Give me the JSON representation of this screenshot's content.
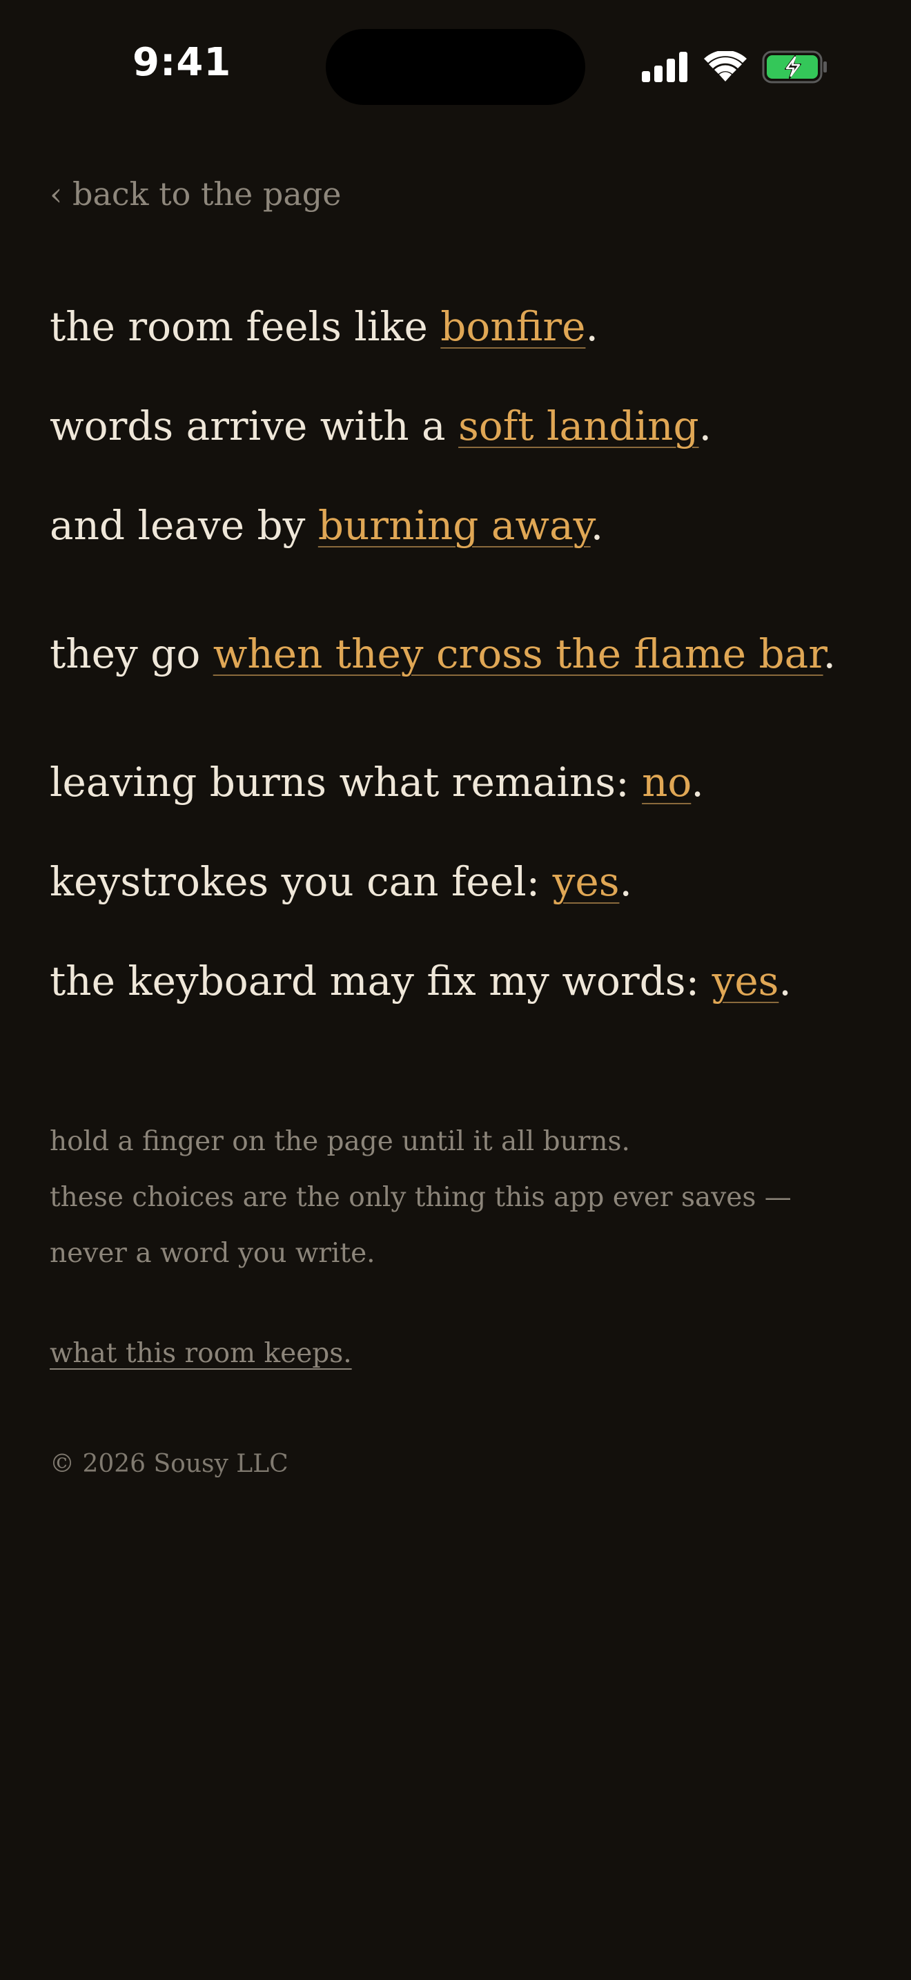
{
  "status_bar": {
    "time": "9:41",
    "icons": [
      "cellular-signal-icon",
      "wifi-icon",
      "battery-charging-icon"
    ],
    "battery_color": "#34c759"
  },
  "nav": {
    "back_label": "‹ back to the page"
  },
  "settings": {
    "room": {
      "prefix": "the room feels like ",
      "value": "bonfire",
      "suffix": "."
    },
    "arrive": {
      "prefix": "words arrive with a ",
      "value": "soft landing",
      "suffix": "."
    },
    "leave": {
      "prefix": "and leave by ",
      "value": "burning away",
      "suffix": "."
    },
    "go": {
      "prefix": "they go ",
      "value": "when they cross the flame bar",
      "suffix": "."
    },
    "remains": {
      "prefix": "leaving burns what remains: ",
      "value": "no",
      "suffix": "."
    },
    "keystrokes": {
      "prefix": "keystrokes you can feel: ",
      "value": "yes",
      "suffix": "."
    },
    "autocorrect": {
      "prefix": "the keyboard may fix my words: ",
      "value": "yes",
      "suffix": "."
    }
  },
  "notes": {
    "line1": "hold a finger on the page until it all burns.",
    "line2": "these choices are the only thing this app ever saves —",
    "line3": "never a word you write."
  },
  "footer": {
    "keeps_link": "what this room keeps.",
    "copyright": "© 2026 Sousy LLC"
  },
  "colors": {
    "background": "#13100c",
    "text": "#efe7d9",
    "accent": "#e0a755",
    "muted": "#8c857a"
  }
}
